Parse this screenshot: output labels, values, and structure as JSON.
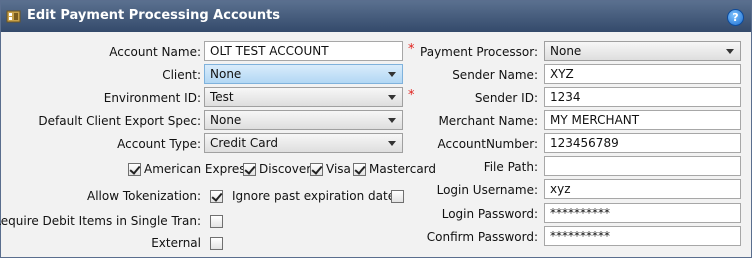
{
  "window": {
    "title": "Edit Payment Processing Accounts",
    "help_glyph": "?"
  },
  "left": {
    "account_name": {
      "label": "Account Name:",
      "value": "OLT TEST ACCOUNT",
      "required": "*"
    },
    "client": {
      "label": "Client:",
      "value": "None"
    },
    "environment_id": {
      "label": "Environment ID:",
      "value": "Test",
      "required": "*"
    },
    "default_client_export_spec": {
      "label": "Default Client Export Spec:",
      "value": "None"
    },
    "account_type": {
      "label": "Account Type:",
      "value": "Credit Card"
    },
    "cards": [
      {
        "label": "American Express",
        "checked": true
      },
      {
        "label": "Discover",
        "checked": true
      },
      {
        "label": "Visa",
        "checked": true
      },
      {
        "label": "Mastercard",
        "checked": true
      }
    ],
    "allow_tokenization": {
      "label": "Allow Tokenization:",
      "checked": true
    },
    "ignore_past_expiration": {
      "label": "Ignore past expiration dates:",
      "checked": false
    },
    "require_debit_items": {
      "label": "Require Debit Items in Single Tran:",
      "checked": false
    },
    "external": {
      "label": "External",
      "checked": false
    }
  },
  "right": {
    "payment_processor": {
      "label": "Payment Processor:",
      "value": "None"
    },
    "sender_name": {
      "label": "Sender Name:",
      "value": "XYZ"
    },
    "sender_id": {
      "label": "Sender ID:",
      "value": "1234"
    },
    "merchant_name": {
      "label": "Merchant Name:",
      "value": "MY MERCHANT"
    },
    "account_number": {
      "label": "AccountNumber:",
      "value": "123456789"
    },
    "file_path": {
      "label": "File Path:",
      "value": ""
    },
    "login_username": {
      "label": "Login Username:",
      "value": "xyz"
    },
    "login_password": {
      "label": "Login Password:",
      "value": "**********"
    },
    "confirm_password": {
      "label": "Confirm Password:",
      "value": "**********"
    }
  },
  "colors": {
    "title_bar": "#45597a",
    "required": "#e0201c",
    "selected_dropdown": "#b2d7f4"
  }
}
